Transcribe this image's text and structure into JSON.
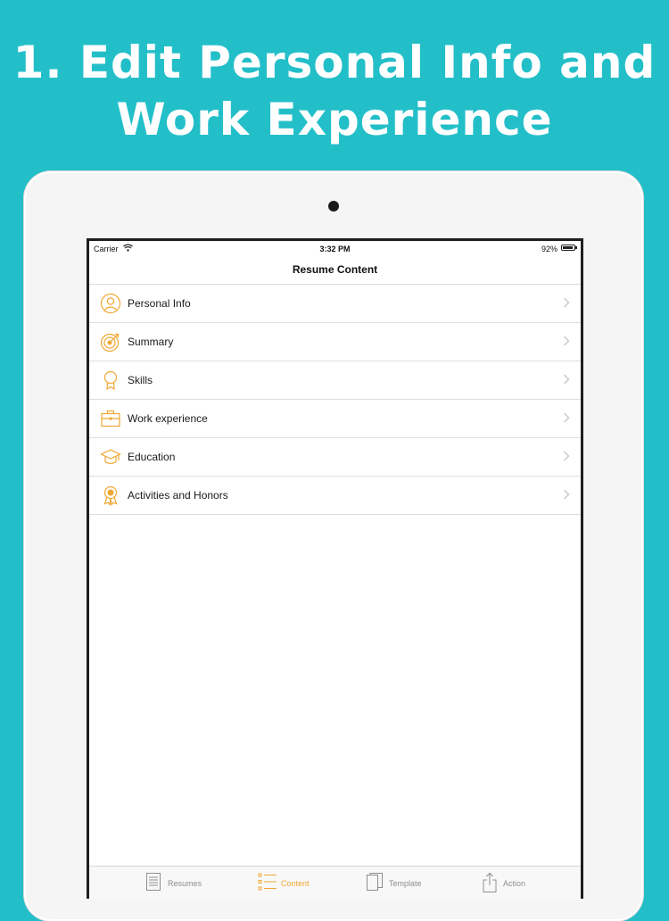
{
  "headline": {
    "line1": "1. Edit Personal Info and",
    "line2": "Work Experience"
  },
  "colors": {
    "background": "#23bfc9",
    "accent": "#f0a732"
  },
  "status_bar": {
    "carrier": "Carrier",
    "time": "3:32 PM",
    "battery": "92%"
  },
  "nav": {
    "title": "Resume Content"
  },
  "sections": [
    {
      "label": "Personal Info",
      "icon": "person-icon"
    },
    {
      "label": "Summary",
      "icon": "target-icon"
    },
    {
      "label": "Skills",
      "icon": "medal-icon"
    },
    {
      "label": "Work experience",
      "icon": "briefcase-icon"
    },
    {
      "label": "Education",
      "icon": "graduation-cap-icon"
    },
    {
      "label": "Activities and Honors",
      "icon": "award-ribbon-icon"
    }
  ],
  "tabs": [
    {
      "label": "Resumes",
      "icon": "document-list-icon",
      "active": false
    },
    {
      "label": "Content",
      "icon": "list-icon",
      "active": true
    },
    {
      "label": "Template",
      "icon": "pages-icon",
      "active": false
    },
    {
      "label": "Action",
      "icon": "share-icon",
      "active": false
    }
  ]
}
